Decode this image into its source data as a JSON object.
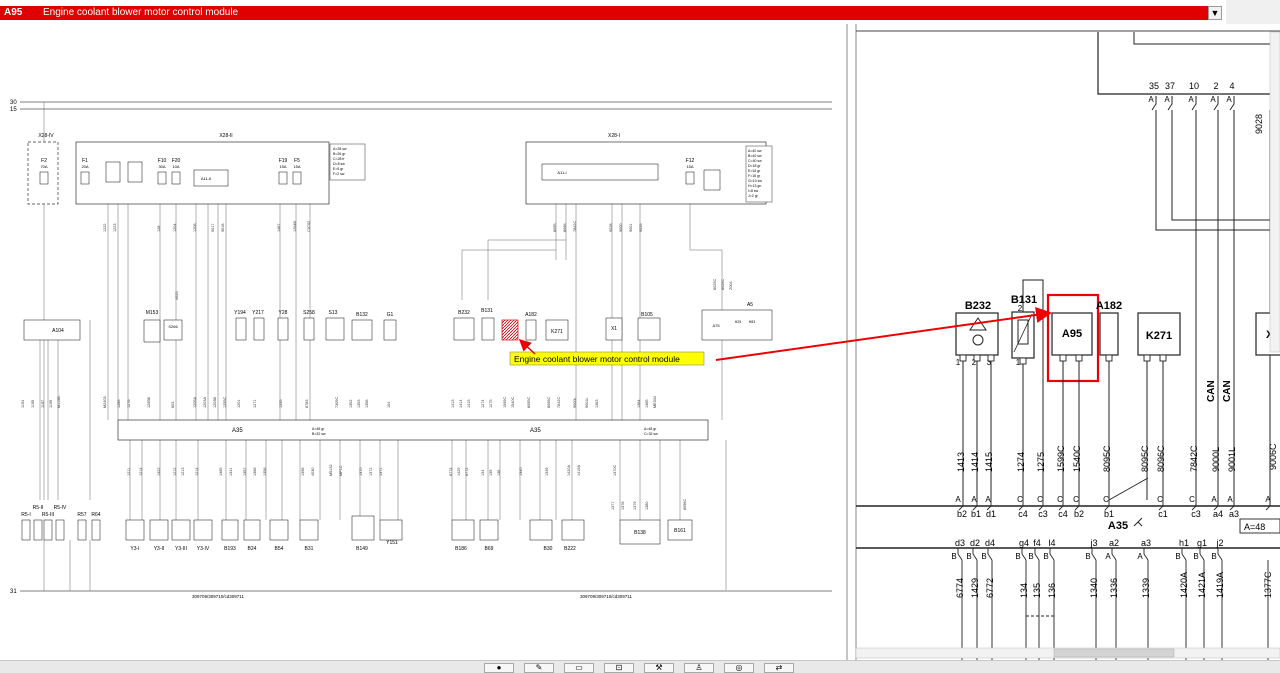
{
  "window": {
    "code": "A95",
    "title": "Engine coolant blower motor control module"
  },
  "left": {
    "rails": [
      "30",
      "15"
    ],
    "ground": "31",
    "fuse_boxes": [
      {
        "name": "X28-IV"
      },
      {
        "name": "X28-II"
      },
      {
        "name": "X28-I"
      }
    ],
    "fuses": [
      {
        "name": "F2",
        "rating": "70A"
      },
      {
        "name": "F1",
        "rating": "20A"
      },
      {
        "name": "F10",
        "rating": "30A"
      },
      {
        "name": "F20",
        "rating": "10A"
      },
      {
        "name": "F19",
        "rating": "15A"
      },
      {
        "name": "F5",
        "rating": "15A"
      },
      {
        "name": "F12",
        "rating": "15A"
      }
    ],
    "relays": [
      "A11-II",
      "A11-I"
    ],
    "legend_left": [
      "A=28 sw",
      "B=26 gr",
      "C=28 fr",
      "D=8 sw",
      "E=5 gr",
      "F=2 sw"
    ],
    "legend_right": [
      "A=40 sw",
      "B=40 sw",
      "C=40 sw",
      "D=18 gr",
      "E=16 gr",
      "F=16 gr",
      "G=10 sw",
      "H=13 gn",
      "I=8 sw",
      "J=2 gr"
    ],
    "components_top": [
      "A104",
      "M153",
      "S266",
      "Y194",
      "Y217",
      "Y28",
      "S258",
      "S13",
      "B132",
      "G1",
      "B232",
      "B131",
      "A182",
      "K271",
      "X1",
      "B105",
      "A5"
    ],
    "a5_labels": [
      "A75",
      "H25",
      "H83"
    ],
    "components_bottom": [
      "R5-I",
      "R5-II",
      "R5-III",
      "R5-IV",
      "R57",
      "R64",
      "Y3-I",
      "Y3-II",
      "Y3-III",
      "Y3-IV",
      "B193",
      "B24",
      "B54",
      "B31",
      "B149",
      "Y151",
      "B186",
      "B69",
      "B30",
      "B222",
      "B138",
      "B161"
    ],
    "bus_name": "A35",
    "bus_legend_a": [
      "A=48 gr",
      "B=32 sw"
    ],
    "bus_legend_b": [
      "A=48 gr",
      "C=32 sw"
    ],
    "ref1": "309709/309710/cd309711",
    "ref2": "309709/309710/cd309711",
    "highlight_label": "Engine coolant blower motor control module",
    "wires_top": [
      "1222",
      "1223",
      "128",
      "1204",
      "1206",
      "9017",
      "9018",
      "1467",
      "1264B",
      "C0702",
      "8095",
      "8096",
      "7842C",
      "9028",
      "9000",
      "9001",
      "9026",
      "8025C",
      "8026C",
      "Z004"
    ],
    "wires_mid": [
      "1194",
      "1195",
      "1197",
      "1199",
      "M115B",
      "M2403",
      "1286",
      "1276",
      "1265B",
      "603",
      "4025",
      "1205A",
      "1203A",
      "1203B",
      "1255C",
      "1201",
      "1271",
      "1255",
      "8783",
      "7309C",
      "1352",
      "1353",
      "1356",
      "104",
      "1413",
      "1414",
      "1415",
      "1274",
      "1275",
      "1599C",
      "1540C",
      "8095C",
      "8096C",
      "7842C",
      "9000L",
      "9001L",
      "1363",
      "1364",
      "1365",
      "ME034"
    ],
    "wires_bottom": [
      "1211",
      "1214",
      "1322",
      "1212",
      "1213",
      "1214",
      "1365",
      "1341",
      "1357",
      "1366",
      "1356",
      "1398",
      "4030",
      "M5132",
      "MP1C",
      "1370",
      "1372",
      "1371",
      "6774",
      "1429",
      "6772",
      "134",
      "135",
      "136",
      "1340",
      "1339",
      "1420A",
      "1419A",
      "1370C",
      "1377",
      "1378",
      "1379",
      "1380",
      "8098C"
    ]
  },
  "right": {
    "top_pins": [
      "35",
      "37",
      "10",
      "2",
      "4"
    ],
    "pin_letters_top": [
      "A",
      "A",
      "A",
      "A",
      "A"
    ],
    "id_9028": "9028",
    "id_9006c": "9006C",
    "components": [
      "B232",
      "B131",
      "A95",
      "A182",
      "K271",
      "X"
    ],
    "pin_numbers_b232": [
      "1",
      "2",
      "3"
    ],
    "pin_numbers_b131": [
      "1",
      "2"
    ],
    "can_labels": [
      "CAN",
      "CAN"
    ],
    "wire_labels": [
      "1413",
      "1414",
      "1415",
      "1274",
      "1275",
      "1599C",
      "1540C",
      "8095C",
      "8095C",
      "8096C",
      "7842C",
      "9000L",
      "9001L"
    ],
    "pin_type_letters": [
      "A",
      "A",
      "A",
      "C",
      "C",
      "C",
      "C",
      "C",
      "C",
      "C",
      "A",
      "A",
      "A"
    ],
    "pin_names": [
      "b2",
      "b1",
      "d1",
      "c4",
      "c3",
      "c4",
      "b2",
      "b1",
      "c1",
      "c3",
      "a4",
      "a3"
    ],
    "bus_name": "A35",
    "bus_legend": "A=48",
    "lower_pin_types": [
      "B",
      "B",
      "B",
      "B",
      "B",
      "B",
      "B",
      "A",
      "A",
      "B",
      "B",
      "B"
    ],
    "lower_pin_names": [
      "d3",
      "d2",
      "d4",
      "g4",
      "f4",
      "l4",
      "j3",
      "a2",
      "a3",
      "h1",
      "g1",
      "j2"
    ],
    "lower_wires": [
      "6774",
      "1429",
      "6772",
      "134",
      "135",
      "136",
      "1340",
      "1336",
      "1339",
      "1420A",
      "1421A",
      "1419A",
      "1377C"
    ]
  },
  "colors": {
    "title_bg": "#e00000",
    "highlight_bg": "#ffff00",
    "callout": "#ee0000",
    "target_fill": "#f2a0a0"
  },
  "icons": [
    "chevron-down-icon",
    "globe-icon",
    "pen-icon",
    "window-icon",
    "tool-icon",
    "wrench-icon",
    "person-icon",
    "eye-icon",
    "arrows-icon"
  ]
}
